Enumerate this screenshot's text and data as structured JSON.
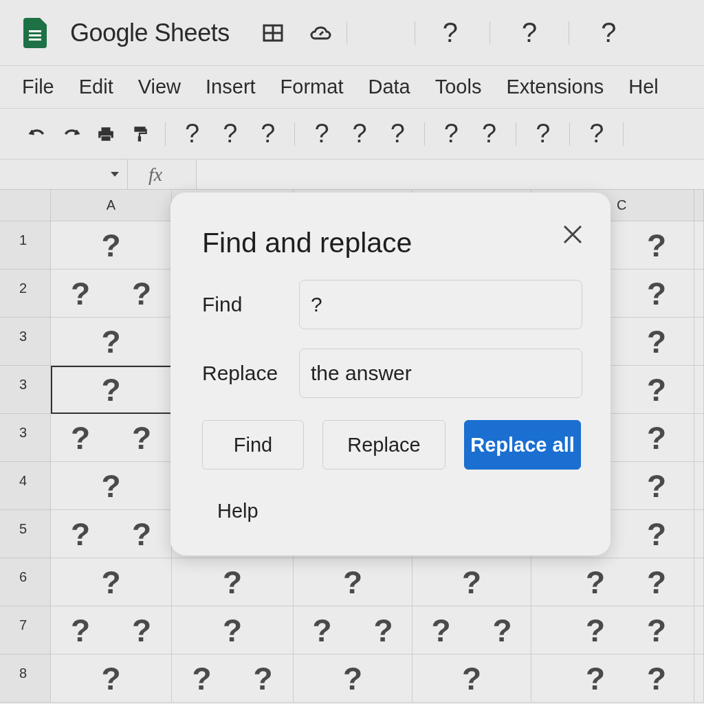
{
  "app": {
    "title": "Google Sheets",
    "header_buttons": [
      "?",
      "?",
      "?"
    ]
  },
  "menu": [
    "File",
    "Edit",
    "View",
    "Insert",
    "Format",
    "Data",
    "Tools",
    "Extensions",
    "Hel"
  ],
  "toolbar": {
    "groups": [
      [
        "?",
        "?",
        "?"
      ],
      [
        "?",
        "?",
        "?"
      ],
      [
        "?",
        "?"
      ],
      [
        "?"
      ],
      [
        "?"
      ]
    ]
  },
  "formula_bar": {
    "fx": "fx"
  },
  "sheet": {
    "column_headers": [
      "A",
      "C"
    ],
    "rows": [
      {
        "header": "1",
        "cells": [
          {
            "text": "?",
            "selected": false
          },
          {
            "text": "?",
            "selected": false
          }
        ]
      },
      {
        "header": "2",
        "cells": [
          {
            "text": "? ?",
            "selected": false
          },
          {
            "text": "?",
            "selected": false
          }
        ]
      },
      {
        "header": "3",
        "cells": [
          {
            "text": "?",
            "selected": false
          },
          {
            "text": "?",
            "selected": false
          }
        ]
      },
      {
        "header": "3",
        "cells": [
          {
            "text": "?",
            "selected": true
          },
          {
            "text": "?",
            "selected": false
          }
        ]
      },
      {
        "header": "3",
        "cells": [
          {
            "text": "? ?",
            "selected": false
          },
          {
            "text": "?",
            "selected": false
          }
        ]
      },
      {
        "header": "4",
        "cells": [
          {
            "text": "?",
            "selected": false
          },
          {
            "text": "?",
            "selected": false
          }
        ]
      },
      {
        "header": "5",
        "cells": [
          {
            "text": "? ?",
            "selected": false
          },
          {
            "text": "?",
            "selected": false
          }
        ]
      },
      {
        "header": "6",
        "cells": [
          {
            "text": "?",
            "selected": false
          },
          {
            "text": "?",
            "selected": false
          },
          {
            "text": "?",
            "selected": false
          },
          {
            "text": "?",
            "selected": false
          },
          {
            "text": "? ?",
            "selected": false
          }
        ]
      },
      {
        "header": "7",
        "cells": [
          {
            "text": "? ?",
            "selected": false
          },
          {
            "text": "?",
            "selected": false
          },
          {
            "text": "? ?",
            "selected": false
          },
          {
            "text": "? ?",
            "selected": false
          },
          {
            "text": "? ?",
            "selected": false
          }
        ]
      },
      {
        "header": "8",
        "cells": [
          {
            "text": "?",
            "selected": false
          },
          {
            "text": "? ?",
            "selected": false
          },
          {
            "text": "?",
            "selected": false
          },
          {
            "text": "?",
            "selected": false
          },
          {
            "text": "? ?",
            "selected": false
          }
        ]
      }
    ]
  },
  "dialog": {
    "title": "Find and replace",
    "fields": [
      {
        "label": "Find",
        "value": "?"
      },
      {
        "label": "Replace",
        "value": "the answer"
      }
    ],
    "buttons": [
      {
        "label": "Find",
        "kind": "secondary"
      },
      {
        "label": "Replace",
        "kind": "secondary"
      },
      {
        "label": "Replace all",
        "kind": "primary"
      }
    ],
    "help": "Help"
  }
}
